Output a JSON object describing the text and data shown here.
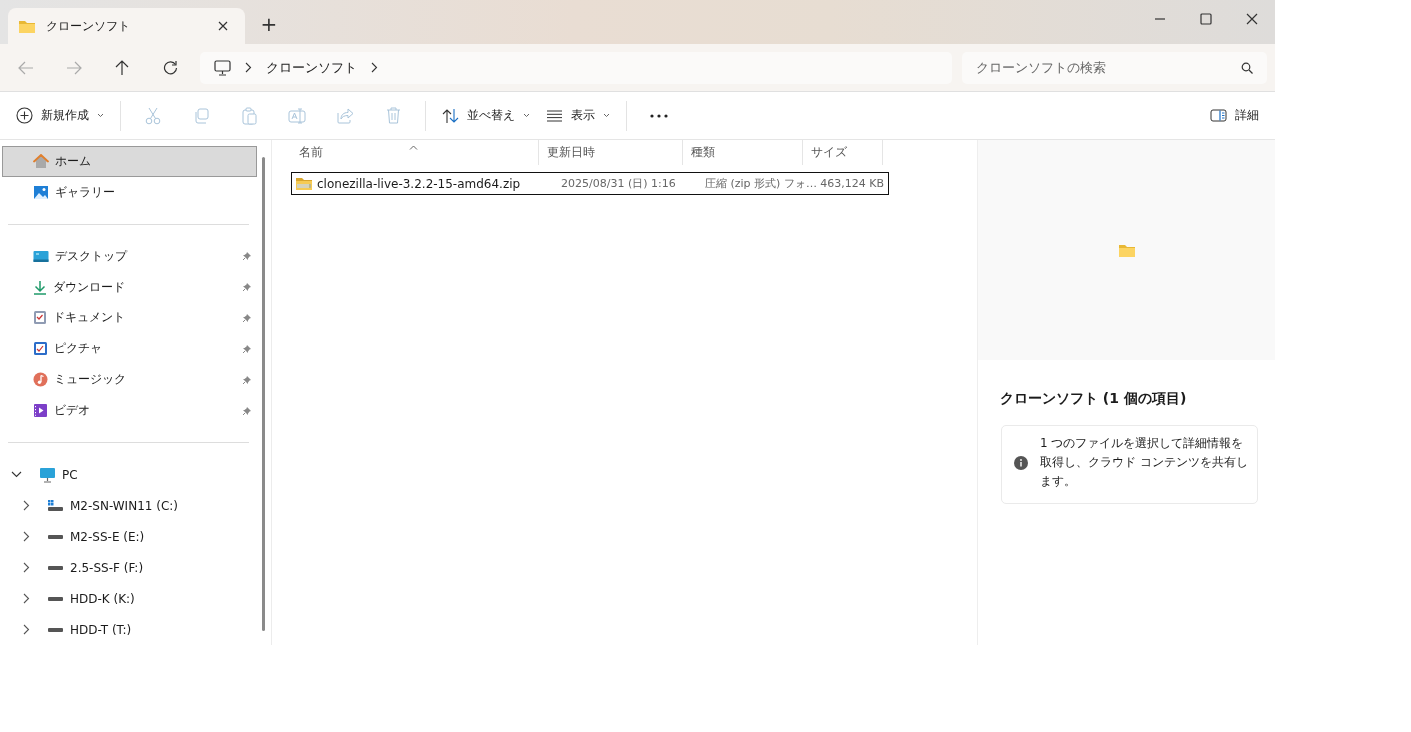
{
  "tab": {
    "title": "クローンソフト",
    "selected": true
  },
  "new_tab": "+",
  "breadcrumb": [
    "クローンソフト"
  ],
  "search": {
    "placeholder": "クローンソフトの検索"
  },
  "commands": [
    {
      "kind": "menu",
      "label": "新規作成",
      "disabled": false
    },
    {
      "kind": "icon",
      "disabled": true
    },
    {
      "kind": "icon",
      "disabled": true
    },
    {
      "kind": "icon",
      "disabled": true
    },
    {
      "kind": "icon",
      "disabled": true
    },
    {
      "kind": "icon",
      "disabled": true
    },
    {
      "kind": "icon",
      "disabled": true
    },
    {
      "kind": "menu",
      "label": "並べ替え",
      "disabled": false
    },
    {
      "kind": "menu",
      "label": "表示",
      "disabled": false
    },
    {
      "kind": "more",
      "disabled": false
    }
  ],
  "details_button": "詳細",
  "sidebar": {
    "quick": [
      {
        "label": "ホーム",
        "selected": true
      },
      {
        "label": "ギャラリー",
        "selected": false
      }
    ],
    "pinned": [
      {
        "label": "デスクトップ",
        "pinned": true
      },
      {
        "label": "ダウンロード",
        "pinned": true
      },
      {
        "label": "ドキュメント",
        "pinned": true
      },
      {
        "label": "ピクチャ",
        "pinned": true
      },
      {
        "label": "ミュージック",
        "pinned": true
      },
      {
        "label": "ビデオ",
        "pinned": true
      }
    ],
    "tree": [
      {
        "label": "PC",
        "expanded": true,
        "children": [
          {
            "label": "M2-SN-WIN11 (C:)",
            "expanded": false
          },
          {
            "label": "M2-SS-E (E:)",
            "expanded": false
          },
          {
            "label": "2.5-SS-F (F:)",
            "expanded": false
          },
          {
            "label": "HDD-K (K:)",
            "expanded": false
          },
          {
            "label": "HDD-T (T:)",
            "expanded": false
          }
        ]
      }
    ]
  },
  "columns": [
    {
      "label": "名前",
      "sorted": true
    },
    {
      "label": "更新日時",
      "sorted": false
    },
    {
      "label": "種類",
      "sorted": false
    },
    {
      "label": "サイズ",
      "sorted": false
    }
  ],
  "rows": [
    {
      "name": "clonezilla-live-3.2.2-15-amd64.zip",
      "modified": "2025/08/31 (日) 1:16",
      "type": "圧縮 (zip 形式) フォ…",
      "size": "463,124 KB",
      "selected": true
    }
  ],
  "details": {
    "title": "クローンソフト (1 個の項目)",
    "info": "1 つのファイルを選択して詳細情報を取得し、クラウド コンテンツを共有します。"
  }
}
